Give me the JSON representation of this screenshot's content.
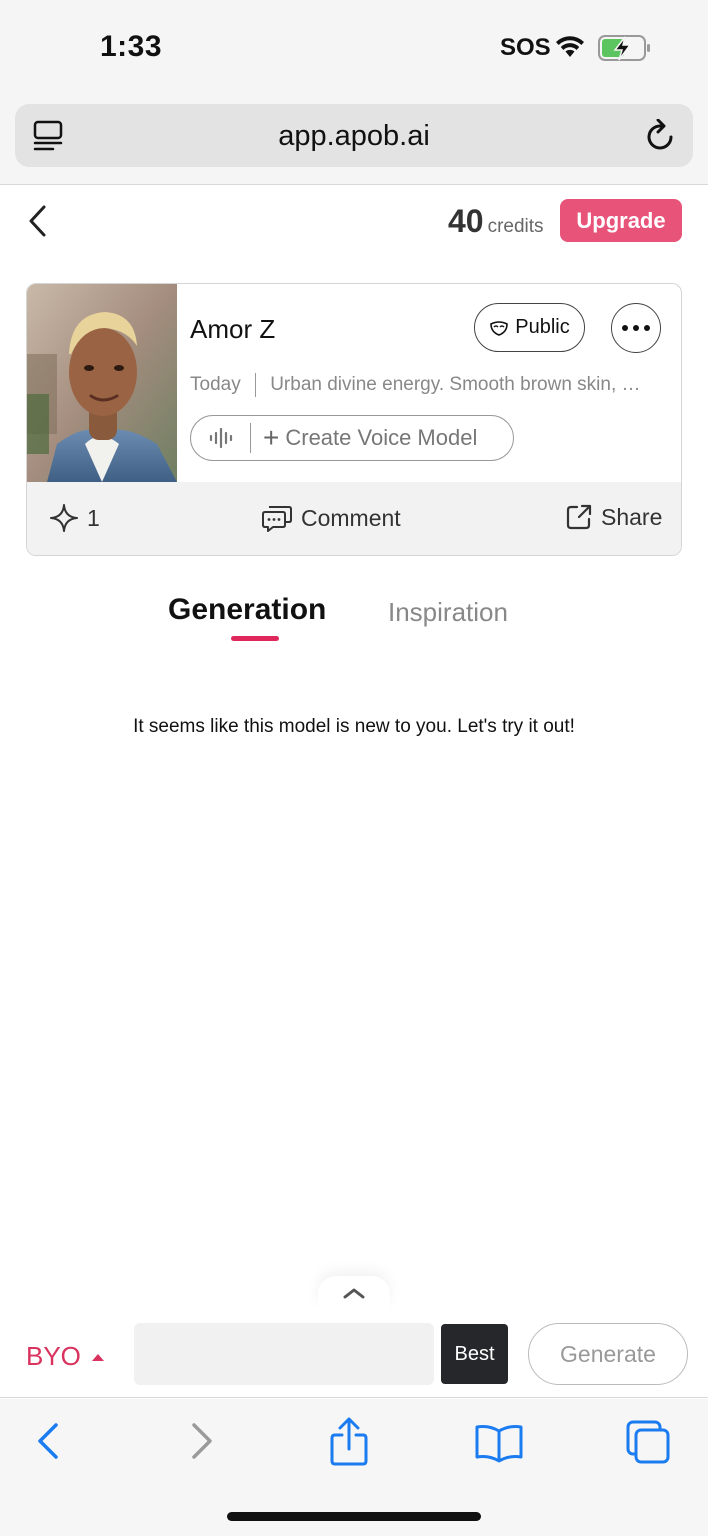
{
  "status_bar": {
    "time": "1:33",
    "sos": "SOS"
  },
  "browser": {
    "url": "app.apob.ai"
  },
  "header": {
    "credits_value": "40",
    "credits_unit": "credits",
    "upgrade_label": "Upgrade"
  },
  "model_card": {
    "name": "Amor Z",
    "visibility_label": "Public",
    "date": "Today",
    "description": "Urban divine energy. Smooth brown skin, …",
    "voice_button_label": "Create Voice Model",
    "likes": "1",
    "comment_label": "Comment",
    "share_label": "Share"
  },
  "tabs": [
    {
      "label": "Generation",
      "active": true
    },
    {
      "label": "Inspiration",
      "active": false
    }
  ],
  "empty_message": "It seems like this model is new to you. Let's try it out!",
  "generate_bar": {
    "mode_label": "BYO",
    "prompt_value": "",
    "quality_label": "Best",
    "generate_label": "Generate"
  },
  "colors": {
    "accent": "#e0275b",
    "upgrade": "#e8537a",
    "ios_blue": "#1a7cf0"
  }
}
